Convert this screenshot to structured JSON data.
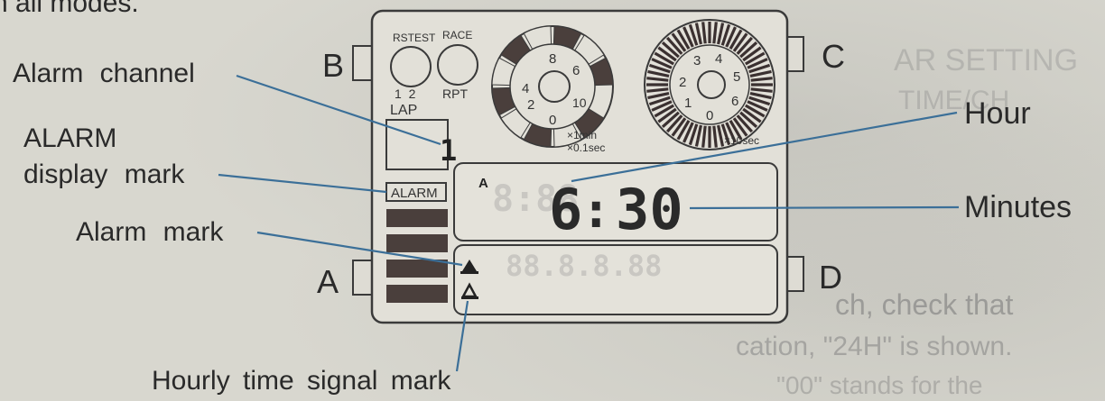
{
  "header": {
    "partial_text": "n all modes."
  },
  "watch": {
    "buttons": {
      "a": "A",
      "b": "B",
      "c": "C",
      "d": "D"
    },
    "top_left_labels": {
      "rstest": "RSTEST",
      "race": "RACE",
      "lap_numbers": "1  2",
      "lap": "LAP",
      "rpt": "RPT"
    },
    "dial_minutes": {
      "numbers": [
        "8",
        "6",
        "4",
        "2",
        "0",
        "10"
      ],
      "unit_min": "×1min",
      "unit_sec": "×0.1sec"
    },
    "dial_seconds": {
      "numbers": [
        "3",
        "4",
        "2",
        "5",
        "1",
        "6",
        "0"
      ],
      "unit": "×10sec"
    },
    "channel_value": "1",
    "alarm_tag": "ALARM",
    "display_a": "A",
    "time_hour": "6",
    "time_colon": ":",
    "time_minutes": "30"
  },
  "callouts": {
    "alarm_channel": "Alarm channel",
    "alarm_display_line1": "ALARM",
    "alarm_display_line2": "display mark",
    "alarm_mark": "Alarm mark",
    "hourly_signal": "Hourly time signal mark",
    "hour": "Hour",
    "minutes": "Minutes"
  },
  "background_text": {
    "r1": "AR SETTING",
    "r2": "TIME/CH",
    "r3": "ch, check that",
    "r4": "cation, \"24H\" is shown.",
    "r5": "\"00\" stands for the"
  }
}
